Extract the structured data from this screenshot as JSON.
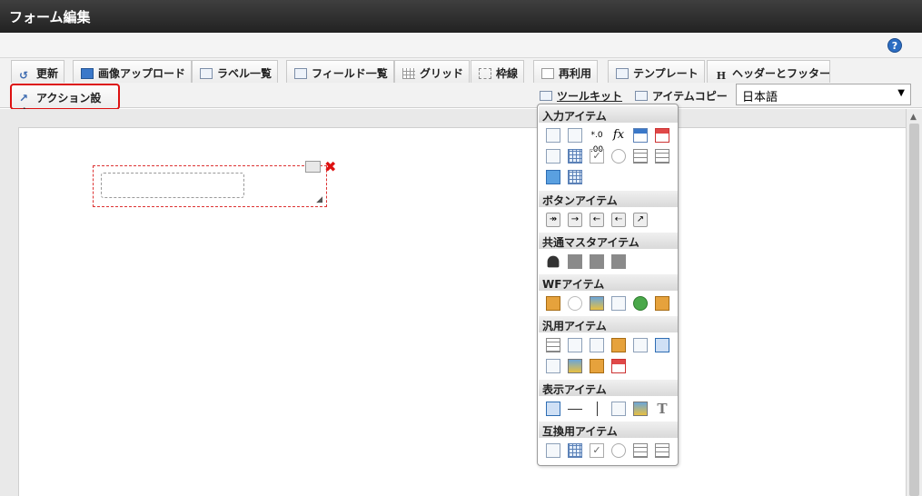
{
  "window": {
    "title": "フォーム編集"
  },
  "help": {
    "label": "?"
  },
  "tabs_row1": [
    "更新",
    "画像アップロード",
    "ラベル一覧",
    "フィールド一覧",
    "グリッド",
    "枠線",
    "再利用",
    "テンプレート",
    "ヘッダーとフッター"
  ],
  "tabs_row2": {
    "action": "アクション設定",
    "toolkit": "ツールキット",
    "item_copy": "アイテムコピー"
  },
  "language": {
    "selected": "日本語"
  },
  "toolkit": {
    "sections": [
      "入力アイテム",
      "ボタンアイテム",
      "共通マスタアイテム",
      "WFアイテム",
      "汎用アイテム",
      "表示アイテム",
      "互換用アイテム"
    ],
    "fx_label": "fx",
    "num_label": "*.0 .00",
    "t_label": "T",
    "check_label": "✓"
  }
}
